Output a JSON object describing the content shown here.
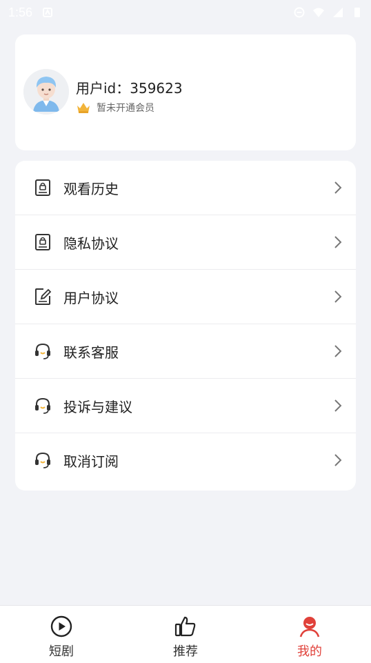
{
  "status_bar": {
    "time": "1:56"
  },
  "profile": {
    "user_id_text": "用户id：359623",
    "vip_status": "暂未开通会员"
  },
  "menu": [
    {
      "label": "观看历史",
      "icon": "document-lock-icon"
    },
    {
      "label": "隐私协议",
      "icon": "document-lock-icon"
    },
    {
      "label": "用户协议",
      "icon": "edit-document-icon"
    },
    {
      "label": "联系客服",
      "icon": "headset-icon"
    },
    {
      "label": "投诉与建议",
      "icon": "headset-icon"
    },
    {
      "label": "取消订阅",
      "icon": "headset-icon"
    }
  ],
  "tabs": [
    {
      "label": "短剧",
      "icon": "play-circle-icon",
      "active": false
    },
    {
      "label": "推荐",
      "icon": "thumbs-up-icon",
      "active": false
    },
    {
      "label": "我的",
      "icon": "user-smile-icon",
      "active": true
    }
  ],
  "colors": {
    "accent": "#e0413a",
    "background": "#f2f3f7",
    "card": "#ffffff",
    "crown": "#f2b43a"
  }
}
